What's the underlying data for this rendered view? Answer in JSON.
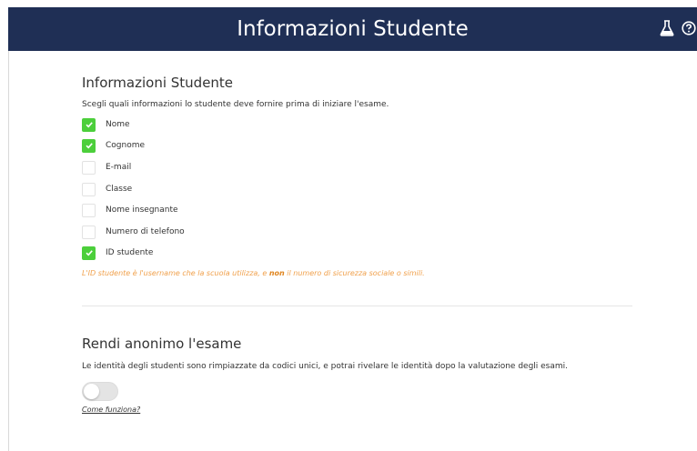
{
  "header": {
    "title": "Informazioni Studente"
  },
  "student_info": {
    "title": "Informazioni Studente",
    "description": "Scegli quali informazioni lo studente deve fornire prima di iniziare l'esame.",
    "options": [
      {
        "label": "Nome",
        "checked": true
      },
      {
        "label": "Cognome",
        "checked": true
      },
      {
        "label": "E-mail",
        "checked": false
      },
      {
        "label": "Classe",
        "checked": false
      },
      {
        "label": "Nome insegnante",
        "checked": false
      },
      {
        "label": "Numero di telefono",
        "checked": false
      },
      {
        "label": "ID studente",
        "checked": true
      }
    ],
    "note_before": "L'ID studente è l'username che la scuola utilizza, e ",
    "note_bold": "non",
    "note_after": " il numero di sicurezza sociale o simili."
  },
  "anonymize": {
    "title": "Rendi anonimo l'esame",
    "description": "Le identità degli studenti sono rimpiazzate da codici unici, e potrai rivelare le identità dopo la valutazione degli esami.",
    "enabled": false,
    "link": "Come funziona?"
  },
  "colors": {
    "header_bg": "#1f2f55",
    "checked": "#4ccf3b",
    "note": "#f0a04b"
  },
  "icons": {
    "flask": "flask-icon",
    "help": "help-circle-icon"
  }
}
